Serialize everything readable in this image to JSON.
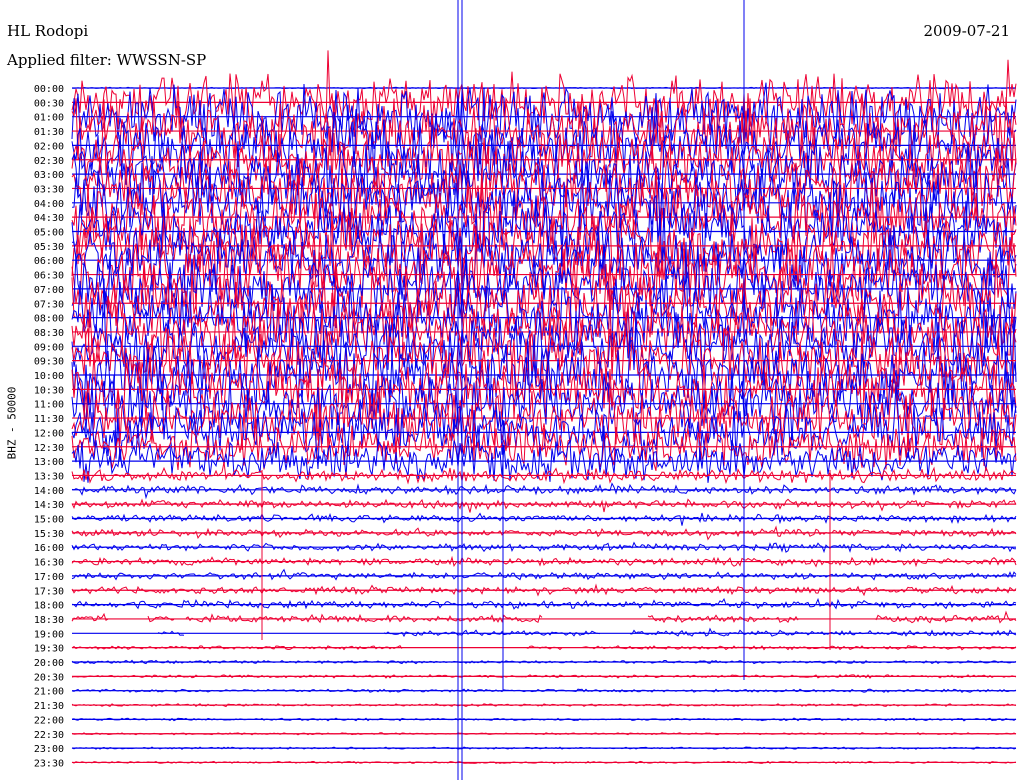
{
  "header": {
    "station": "HL Rodopi",
    "filter": "Applied filter: WWSSN-SP",
    "date": "2009-07-21"
  },
  "chart_data": {
    "type": "line",
    "title": "HL Rodopi",
    "date": "2009-07-21",
    "filter": "WWSSN-SP",
    "ylabel": "BHZ - 50000",
    "row_labels": [
      "00:00",
      "00:30",
      "01:00",
      "01:30",
      "02:00",
      "02:30",
      "03:00",
      "03:30",
      "04:00",
      "04:30",
      "05:00",
      "05:30",
      "06:00",
      "06:30",
      "07:00",
      "07:30",
      "08:00",
      "08:30",
      "09:00",
      "09:30",
      "10:00",
      "10:30",
      "11:00",
      "11:30",
      "12:00",
      "12:30",
      "13:00",
      "13:30",
      "14:00",
      "14:30",
      "15:00",
      "15:30",
      "16:00",
      "16:30",
      "17:00",
      "17:30",
      "18:00",
      "18:30",
      "19:00",
      "19:30",
      "20:00",
      "20:30",
      "21:00",
      "21:30",
      "22:00",
      "22:30",
      "23:00",
      "23:30"
    ],
    "colors": {
      "even_rows": "#0000ee",
      "odd_rows": "#ee0033"
    },
    "row_activity": [
      0.05,
      2.2,
      2.4,
      2.5,
      2.6,
      2.5,
      2.5,
      2.6,
      2.7,
      2.6,
      2.7,
      2.6,
      2.6,
      2.7,
      2.6,
      2.6,
      2.7,
      2.6,
      2.6,
      2.6,
      2.6,
      2.5,
      2.5,
      2.3,
      2.1,
      1.8,
      1.6,
      0.55,
      0.35,
      0.35,
      0.3,
      0.28,
      0.3,
      0.3,
      0.28,
      0.28,
      0.32,
      0.3,
      0.22,
      0.15,
      0.12,
      0.12,
      0.12,
      0.1,
      0.1,
      0.08,
      0.08,
      0.08
    ],
    "gaps": {
      "18:30": [
        [
          0.04,
          0.08
        ],
        [
          0.11,
          0.12
        ],
        [
          0.5,
          0.61
        ],
        [
          0.77,
          0.85
        ]
      ],
      "19:00": [
        [
          0.0,
          0.09
        ],
        [
          0.12,
          0.33
        ],
        [
          0.56,
          0.59
        ]
      ],
      "19:30": [
        [
          0.35,
          0.48
        ],
        [
          0.52,
          0.54
        ]
      ]
    },
    "grid": false,
    "legend": "none"
  }
}
